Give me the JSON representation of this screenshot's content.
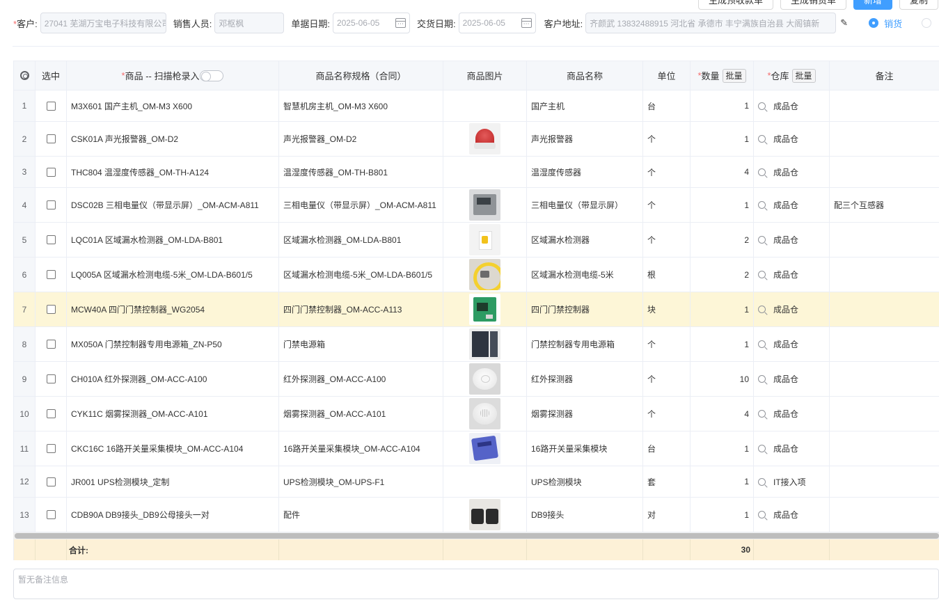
{
  "actions": {
    "generate_advance": "生成预收款单",
    "generate_sales": "生成销货单",
    "new": "新增",
    "copy": "复制"
  },
  "form": {
    "customer_label": "客户:",
    "customer_value": "27041 芜湖万宝电子科技有限公司",
    "salesperson_label": "销售人员:",
    "salesperson_value": "邓枢枫",
    "doc_date_label": "单据日期:",
    "doc_date_value": "2025-06-05",
    "delivery_date_label": "交货日期:",
    "delivery_date_value": "2025-06-05",
    "address_label": "客户地址:",
    "address_value": "齐颜武 13832488915 河北省 承德市 丰宁满族自治县 大阁镇新",
    "radio_sale": "销货"
  },
  "table": {
    "headers": {
      "select": "选中",
      "product": "商品 -- 扫描枪录入",
      "spec": "商品名称规格（合同）",
      "image": "商品图片",
      "name": "商品名称",
      "unit": "单位",
      "qty": "数量",
      "warehouse": "仓库",
      "remark": "备注",
      "batch": "批量"
    },
    "rows": [
      {
        "no": "1",
        "product": "M3X601 国产主机_OM-M3 X600",
        "spec": "智慧机房主机_OM-M3 X600",
        "img": "",
        "name": "国产主机",
        "unit": "台",
        "qty": "1",
        "warehouse": "成品仓",
        "remark": ""
      },
      {
        "no": "2",
        "product": "CSK01A 声光报警器_OM-D2",
        "spec": "声光报警器_OM-D2",
        "img": "alarm",
        "name": "声光报警器",
        "unit": "个",
        "qty": "1",
        "warehouse": "成品仓",
        "remark": ""
      },
      {
        "no": "3",
        "product": "THC804 温湿度传感器_OM-TH-A124",
        "spec": "温湿度传感器_OM-TH-B801",
        "img": "",
        "name": "温湿度传感器",
        "unit": "个",
        "qty": "4",
        "warehouse": "成品仓",
        "remark": ""
      },
      {
        "no": "4",
        "product": "DSC02B 三相电量仪（带显示屏）_OM-ACM-A811",
        "spec": "三相电量仪（带显示屏）_OM-ACM-A811",
        "img": "meter",
        "name": "三相电量仪（带显示屏）",
        "unit": "个",
        "qty": "1",
        "warehouse": "成品仓",
        "remark": "配三个互感器"
      },
      {
        "no": "5",
        "product": "LQC01A 区域漏水检测器_OM-LDA-B801",
        "spec": "区域漏水检测器_OM-LDA-B801",
        "img": "leak",
        "name": "区域漏水检测器",
        "unit": "个",
        "qty": "2",
        "warehouse": "成品仓",
        "remark": ""
      },
      {
        "no": "6",
        "product": "LQ005A 区域漏水检测电缆-5米_OM-LDA-B601/5",
        "spec": "区域漏水检测电缆-5米_OM-LDA-B601/5",
        "img": "cable",
        "name": "区域漏水检测电缆-5米",
        "unit": "根",
        "qty": "2",
        "warehouse": "成品仓",
        "remark": ""
      },
      {
        "no": "7",
        "product": "MCW40A 四门门禁控制器_WG2054",
        "spec": "四门门禁控制器_OM-ACC-A113",
        "img": "pcb",
        "name": "四门门禁控制器",
        "unit": "块",
        "qty": "1",
        "warehouse": "成品仓",
        "remark": ""
      },
      {
        "no": "8",
        "product": "MX050A 门禁控制器专用电源箱_ZN-P50",
        "spec": "门禁电源箱",
        "img": "box",
        "name": "门禁控制器专用电源箱",
        "unit": "个",
        "qty": "1",
        "warehouse": "成品仓",
        "remark": ""
      },
      {
        "no": "9",
        "product": "CH010A 红外探测器_OM-ACC-A100",
        "spec": "红外探测器_OM-ACC-A100",
        "img": "pir",
        "name": "红外探测器",
        "unit": "个",
        "qty": "10",
        "warehouse": "成品仓",
        "remark": ""
      },
      {
        "no": "10",
        "product": "CYK11C 烟雾探测器_OM-ACC-A101",
        "spec": "烟雾探测器_OM-ACC-A101",
        "img": "smoke",
        "name": "烟雾探测器",
        "unit": "个",
        "qty": "4",
        "warehouse": "成品仓",
        "remark": ""
      },
      {
        "no": "11",
        "product": "CKC16C 16路开关量采集模块_OM-ACC-A104",
        "spec": "16路开关量采集模块_OM-ACC-A104",
        "img": "module",
        "name": "16路开关量采集模块",
        "unit": "台",
        "qty": "1",
        "warehouse": "成品仓",
        "remark": ""
      },
      {
        "no": "12",
        "product": "JR001 UPS检测模块_定制",
        "spec": "UPS检测模块_OM-UPS-F1",
        "img": "",
        "name": "UPS检测模块",
        "unit": "套",
        "qty": "1",
        "warehouse": "IT接入项",
        "remark": ""
      },
      {
        "no": "13",
        "product": "CDB90A DB9接头_DB9公母接头一对",
        "spec": "配件",
        "img": "db9",
        "name": "DB9接头",
        "unit": "对",
        "qty": "1",
        "warehouse": "成品仓",
        "remark": ""
      }
    ],
    "highlighted_row": "7",
    "total_label": "合计:",
    "total_qty": "30"
  },
  "remark_placeholder": "暂无备注信息",
  "colors": {
    "primary": "#409eff",
    "required": "#f56c6c",
    "highlight_row": "#fdf6d7",
    "total_row": "#fdf1d7"
  },
  "icons": [
    "calendar-icon",
    "edit-icon",
    "settings-icon",
    "search-icon"
  ]
}
